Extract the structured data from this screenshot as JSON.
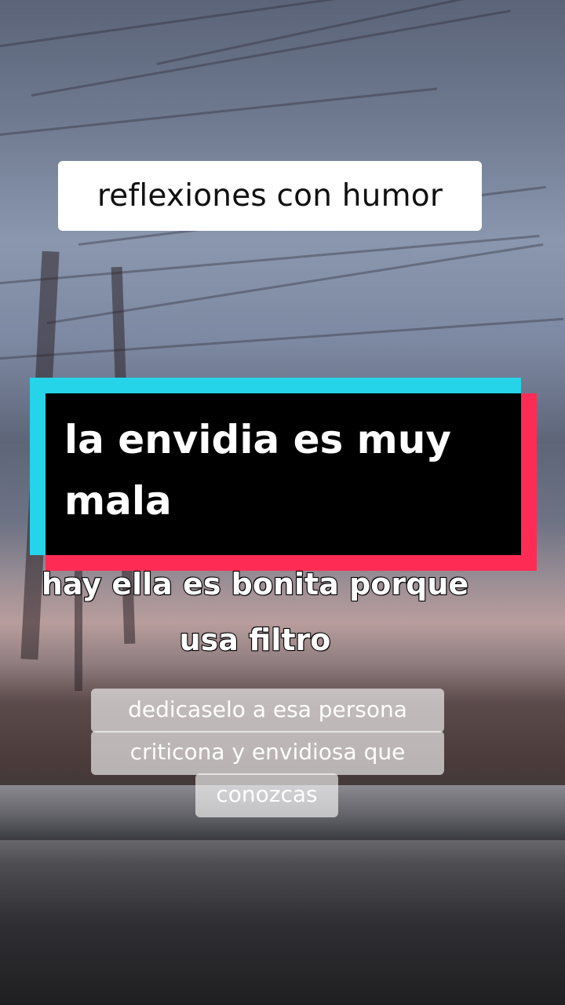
{
  "overlays": {
    "title": "reflexiones con humor",
    "headline_lines": [
      "la envidia es muy",
      "mala"
    ],
    "caption_lines": [
      "hay ella es bonita porque",
      "usa filtro"
    ],
    "sticker_lines": [
      "dedicaselo a esa persona",
      "criticona y envidiosa que",
      "conozcas"
    ]
  },
  "colors": {
    "glitch_cyan": "#25d4e8",
    "glitch_red": "#fe2c55",
    "headline_bg": "#000000",
    "title_bg": "#ffffff"
  }
}
